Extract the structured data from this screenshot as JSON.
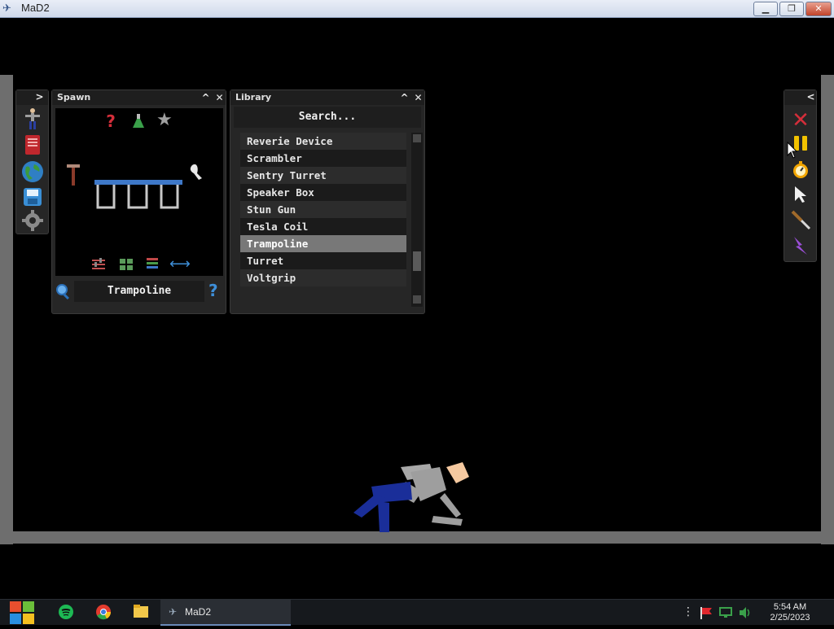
{
  "window": {
    "title": "MaD2",
    "minimize_glyph": "▁",
    "restore_glyph": "❐",
    "close_glyph": "✕"
  },
  "left_toolbar": {
    "collapse_glyph": ">",
    "tools": [
      "ragdoll-icon",
      "red-book-icon",
      "globe-icon",
      "save-icon",
      "settings-gear-icon"
    ]
  },
  "spawn_panel": {
    "title": "Spawn",
    "collapse_glyph": "^",
    "close_glyph": "✕",
    "filter_icons": [
      "question-icon",
      "flask-icon",
      "star-icon"
    ],
    "bottom_icons": [
      "sliders-icon",
      "grid-icon",
      "layers-icon",
      "horizontal-arrows-icon"
    ],
    "selected_name": "Trampoline",
    "help_glyph": "?"
  },
  "library_panel": {
    "title": "Library",
    "collapse_glyph": "^",
    "close_glyph": "✕",
    "search_placeholder": "Search...",
    "items": [
      {
        "label": "Reverie Device"
      },
      {
        "label": "Scrambler"
      },
      {
        "label": "Sentry Turret"
      },
      {
        "label": "Speaker Box"
      },
      {
        "label": "Stun Gun"
      },
      {
        "label": "Tesla Coil"
      },
      {
        "label": "Trampoline",
        "selected": true
      },
      {
        "label": "Turret"
      },
      {
        "label": "Voltgrip"
      }
    ]
  },
  "right_toolbar": {
    "collapse_glyph": "<",
    "tools": [
      "delete-x-icon",
      "pause-icon",
      "stopwatch-icon",
      "cursor-icon",
      "knife-icon",
      "lightning-icon"
    ]
  },
  "taskbar": {
    "app_label": "MaD2",
    "time": "5:54 AM",
    "date": "2/25/2023"
  },
  "colors": {
    "accent_blue": "#3e78c8",
    "wall_gray": "#6e6e6e",
    "selected_row": "#787878",
    "ragdoll_shirt": "#9e9e9e",
    "ragdoll_pants": "#1a2e99",
    "ragdoll_skin": "#f5c9a0"
  }
}
